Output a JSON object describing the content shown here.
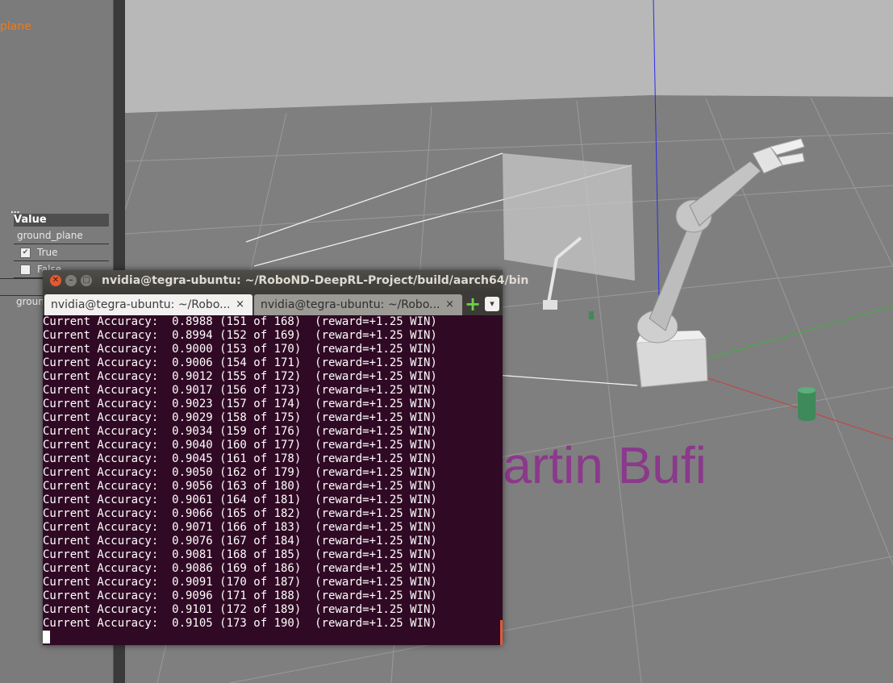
{
  "left_panel": {
    "link_text": "plane",
    "dots": "...",
    "header": "Value",
    "rows": [
      {
        "value": "ground_plane"
      },
      {
        "value": "True",
        "checked": true
      },
      {
        "value": "False",
        "checked": false
      }
    ],
    "bottom_value": "ground"
  },
  "overlay_text": "Martin Bufi",
  "terminal": {
    "window_title": "nvidia@tegra-ubuntu: ~/RoboND-DeepRL-Project/build/aarch64/bin",
    "tabs": [
      {
        "label": "nvidia@tegra-ubuntu: ~/Robo...",
        "active": true
      },
      {
        "label": "nvidia@tegra-ubuntu: ~/Robo...",
        "active": false
      }
    ],
    "close_glyph": "×",
    "new_tab_glyph": "+",
    "menu_glyph": "▾",
    "lines": [
      "Current Accuracy:  0.8988 (151 of 168)  (reward=+1.25 WIN)",
      "Current Accuracy:  0.8994 (152 of 169)  (reward=+1.25 WIN)",
      "Current Accuracy:  0.9000 (153 of 170)  (reward=+1.25 WIN)",
      "Current Accuracy:  0.9006 (154 of 171)  (reward=+1.25 WIN)",
      "Current Accuracy:  0.9012 (155 of 172)  (reward=+1.25 WIN)",
      "Current Accuracy:  0.9017 (156 of 173)  (reward=+1.25 WIN)",
      "Current Accuracy:  0.9023 (157 of 174)  (reward=+1.25 WIN)",
      "Current Accuracy:  0.9029 (158 of 175)  (reward=+1.25 WIN)",
      "Current Accuracy:  0.9034 (159 of 176)  (reward=+1.25 WIN)",
      "Current Accuracy:  0.9040 (160 of 177)  (reward=+1.25 WIN)",
      "Current Accuracy:  0.9045 (161 of 178)  (reward=+1.25 WIN)",
      "Current Accuracy:  0.9050 (162 of 179)  (reward=+1.25 WIN)",
      "Current Accuracy:  0.9056 (163 of 180)  (reward=+1.25 WIN)",
      "Current Accuracy:  0.9061 (164 of 181)  (reward=+1.25 WIN)",
      "Current Accuracy:  0.9066 (165 of 182)  (reward=+1.25 WIN)",
      "Current Accuracy:  0.9071 (166 of 183)  (reward=+1.25 WIN)",
      "Current Accuracy:  0.9076 (167 of 184)  (reward=+1.25 WIN)",
      "Current Accuracy:  0.9081 (168 of 185)  (reward=+1.25 WIN)",
      "Current Accuracy:  0.9086 (169 of 186)  (reward=+1.25 WIN)",
      "Current Accuracy:  0.9091 (170 of 187)  (reward=+1.25 WIN)",
      "Current Accuracy:  0.9096 (171 of 188)  (reward=+1.25 WIN)",
      "Current Accuracy:  0.9101 (172 of 189)  (reward=+1.25 WIN)",
      "Current Accuracy:  0.9105 (173 of 190)  (reward=+1.25 WIN)"
    ]
  },
  "colors": {
    "terminal_bg": "#300a24",
    "link_orange": "#f07a16",
    "overlay_purple": "#8e2d8e",
    "sky": "#b4b4b4",
    "ground": "#7f7f7f"
  }
}
